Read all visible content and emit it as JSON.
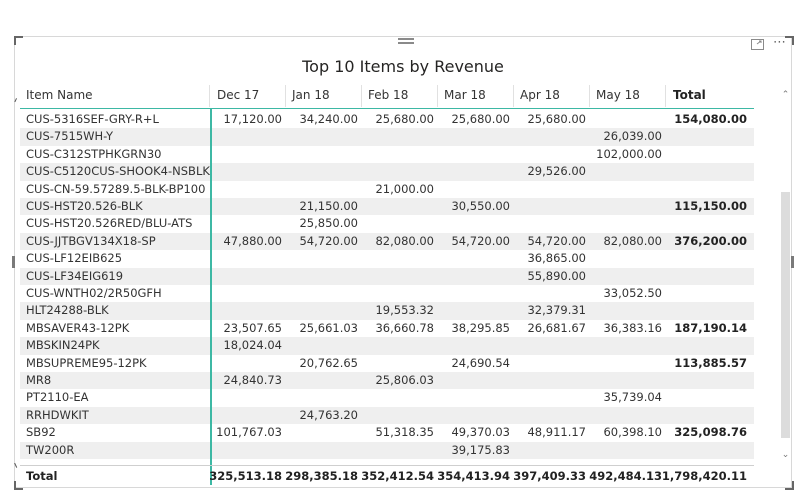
{
  "visual": {
    "title": "Top 10 Items by Revenue",
    "icons": [
      "drag-handle-icon",
      "focus-mode-icon",
      "more-options-icon"
    ],
    "accent_color": "#3db8a4"
  },
  "table": {
    "columns": [
      "Item Name",
      "Dec 17",
      "Jan 18",
      "Feb 18",
      "Mar 18",
      "Apr 18",
      "May 18",
      "Total"
    ],
    "rows": [
      [
        "CUS-5316SEF-GRY-R+L",
        "17,120.00",
        "34,240.00",
        "25,680.00",
        "25,680.00",
        "25,680.00",
        "",
        "154,080.00"
      ],
      [
        "CUS-7515WH-Y",
        "",
        "",
        "",
        "",
        "",
        "26,039.00",
        ""
      ],
      [
        "CUS-C312STPHKGRN30",
        "",
        "",
        "",
        "",
        "",
        "102,000.00",
        ""
      ],
      [
        "CUS-C5120CUS-SHOOK4-NSBLK",
        "",
        "",
        "",
        "",
        "29,526.00",
        "",
        ""
      ],
      [
        "CUS-CN-59.57289.5-BLK-BP100",
        "",
        "",
        "21,000.00",
        "",
        "",
        "",
        ""
      ],
      [
        "CUS-HST20.526-BLK",
        "",
        "21,150.00",
        "",
        "30,550.00",
        "",
        "",
        "115,150.00"
      ],
      [
        "CUS-HST20.526RED/BLU-ATS",
        "",
        "25,850.00",
        "",
        "",
        "",
        "",
        ""
      ],
      [
        "CUS-JJTBGV134X18-SP",
        "47,880.00",
        "54,720.00",
        "82,080.00",
        "54,720.00",
        "54,720.00",
        "82,080.00",
        "376,200.00"
      ],
      [
        "CUS-LF12EIB625",
        "",
        "",
        "",
        "",
        "36,865.00",
        "",
        ""
      ],
      [
        "CUS-LF34EIG619",
        "",
        "",
        "",
        "",
        "55,890.00",
        "",
        ""
      ],
      [
        "CUS-WNTH02/2R50GFH",
        "",
        "",
        "",
        "",
        "",
        "33,052.50",
        ""
      ],
      [
        "HLT24288-BLK",
        "",
        "",
        "19,553.32",
        "",
        "32,379.31",
        "",
        ""
      ],
      [
        "MBSAVER43-12PK",
        "23,507.65",
        "25,661.03",
        "36,660.78",
        "38,295.85",
        "26,681.67",
        "36,383.16",
        "187,190.14"
      ],
      [
        "MBSKIN24PK",
        "18,024.04",
        "",
        "",
        "",
        "",
        "",
        ""
      ],
      [
        "MBSUPREME95-12PK",
        "",
        "20,762.65",
        "",
        "24,690.54",
        "",
        "",
        "113,885.57"
      ],
      [
        "MR8",
        "24,840.73",
        "",
        "25,806.03",
        "",
        "",
        "",
        ""
      ],
      [
        "PT2110-EA",
        "",
        "",
        "",
        "",
        "",
        "35,739.04",
        ""
      ],
      [
        "RRHDWKIT",
        "",
        "24,763.20",
        "",
        "",
        "",
        "",
        ""
      ],
      [
        "SB92",
        "101,767.03",
        "",
        "51,318.35",
        "49,370.03",
        "48,911.17",
        "60,398.10",
        "325,098.76"
      ],
      [
        "TW200R",
        "",
        "",
        "",
        "39,175.83",
        "",
        "",
        ""
      ]
    ],
    "totals": [
      "Total",
      "325,513.18",
      "298,385.18",
      "352,412.54",
      "354,413.94",
      "397,409.33",
      "492,484.13",
      "1,798,420.11"
    ]
  },
  "scrollbar": {
    "up_glyph": "^",
    "down_glyph": "v"
  }
}
